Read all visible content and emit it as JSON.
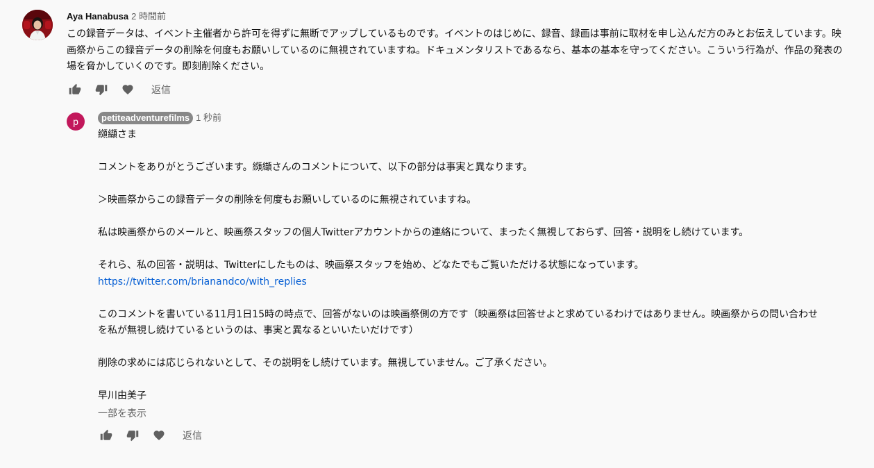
{
  "comment": {
    "author": "Aya Hanabusa",
    "time": "2 時間前",
    "text": "この録音データは、イベント主催者から許可を得ずに無断でアップしているものです。イベントのはじめに、録音、録画は事前に取材を申し込んだ方のみとお伝えしています。映画祭からこの録音データの削除を何度もお願いしているのに無視されていますね。ドキュメンタリストであるなら、基本の基本を守ってください。こういう行為が、作品の発表の場を脅かしていくのです。即刻削除ください。",
    "reply_label": "返信"
  },
  "reply": {
    "avatar_letter": "p",
    "author": "petiteadventurefilms",
    "time": "1 秒前",
    "paragraphs": [
      "纐纈さま",
      "コメントをありがとうございます。纐纈さんのコメントについて、以下の部分は事実と異なります。",
      "＞映画祭からこの録音データの削除を何度もお願いしているのに無視されていますね。",
      "私は映画祭からのメールと、映画祭スタッフの個人Twitterアカウントからの連絡について、まったく無視しておらず、回答・説明をし続けています。",
      "それら、私の回答・説明は、Twitterにしたものは、映画祭スタッフを始め、どなたでもご覧いただける状態になっています。",
      "このコメントを書いている11月1日15時の時点で、回答がないのは映画祭側の方です（映画祭は回答せよと求めているわけではありません。映画祭からの問い合わせを私が無視し続けているというのは、事実と異なるといいたいだけです）",
      "削除の求めには応じられないとして、その説明をし続けています。無視していません。ご了承ください。",
      "早川由美子"
    ],
    "link": "https://twitter.com/brianandco/with_replies",
    "read_more": "一部を表示",
    "reply_label": "返信"
  },
  "icons": {
    "like": "thumbs-up-icon",
    "dislike": "thumbs-down-icon",
    "heart": "heart-icon"
  },
  "colors": {
    "background": "#f9f9f9",
    "link": "#065fd4",
    "author_chip": "#888888",
    "reply_avatar": "#c2185b",
    "muted": "#606060"
  }
}
